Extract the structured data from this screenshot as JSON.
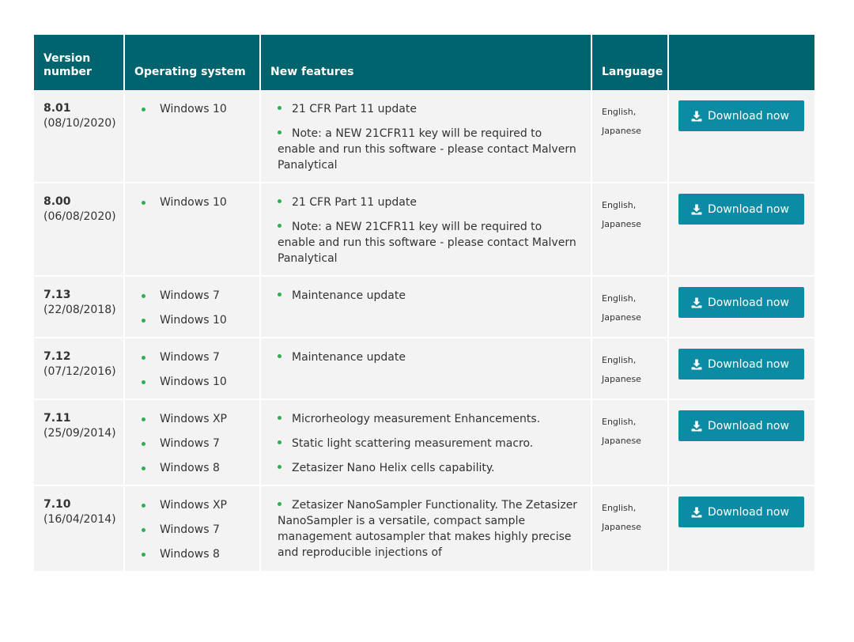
{
  "table": {
    "headers": {
      "version": "Version number",
      "os": "Operating system",
      "features": "New features",
      "language": "Language",
      "action": ""
    },
    "rows": [
      {
        "version": "8.01",
        "date": "(08/10/2020)",
        "os": [
          "Windows 10"
        ],
        "features": [
          "21 CFR Part 11 update",
          "Note: a NEW 21CFR11 key will be required to enable and run this software - please contact Malvern Panalytical"
        ],
        "languages": [
          "English,",
          "Japanese"
        ],
        "download_label": "Download now"
      },
      {
        "version": "8.00",
        "date": "(06/08/2020)",
        "os": [
          "Windows 10"
        ],
        "features": [
          "21 CFR Part 11 update",
          "Note: a NEW 21CFR11 key will be required to enable and run this software - please contact Malvern Panalytical"
        ],
        "languages": [
          "English,",
          "Japanese"
        ],
        "download_label": "Download now"
      },
      {
        "version": "7.13",
        "date": "(22/08/2018)",
        "os": [
          "Windows 7",
          "Windows 10"
        ],
        "features": [
          "Maintenance update"
        ],
        "languages": [
          "English,",
          "Japanese"
        ],
        "download_label": "Download now"
      },
      {
        "version": "7.12",
        "date": "(07/12/2016)",
        "os": [
          "Windows 7",
          "Windows 10"
        ],
        "features": [
          "Maintenance update"
        ],
        "languages": [
          "English,",
          "Japanese"
        ],
        "download_label": "Download now"
      },
      {
        "version": "7.11",
        "date": "(25/09/2014)",
        "os": [
          "Windows XP",
          "Windows 7",
          "Windows 8"
        ],
        "features": [
          "Microrheology measurement Enhancements.",
          "Static light scattering measurement macro.",
          "Zetasizer Nano Helix cells capability."
        ],
        "languages": [
          "English,",
          "Japanese"
        ],
        "download_label": "Download now"
      },
      {
        "version": "7.10",
        "date": "(16/04/2014)",
        "os": [
          "Windows XP",
          "Windows 7",
          "Windows 8"
        ],
        "features": [
          "Zetasizer NanoSampler Functionality. The Zetasizer NanoSampler is a versatile, compact sample management autosampler that makes highly precise and reproducible injections of"
        ],
        "languages": [
          "English,",
          "Japanese"
        ],
        "download_label": "Download now"
      }
    ]
  },
  "colors": {
    "header_bg": "#00646f",
    "row_bg": "#f3f3f3",
    "button_bg": "#0c8ca4",
    "bullet": "#2fae52"
  },
  "icons": {
    "download": "download-icon",
    "bullet": "bullet-dot"
  }
}
